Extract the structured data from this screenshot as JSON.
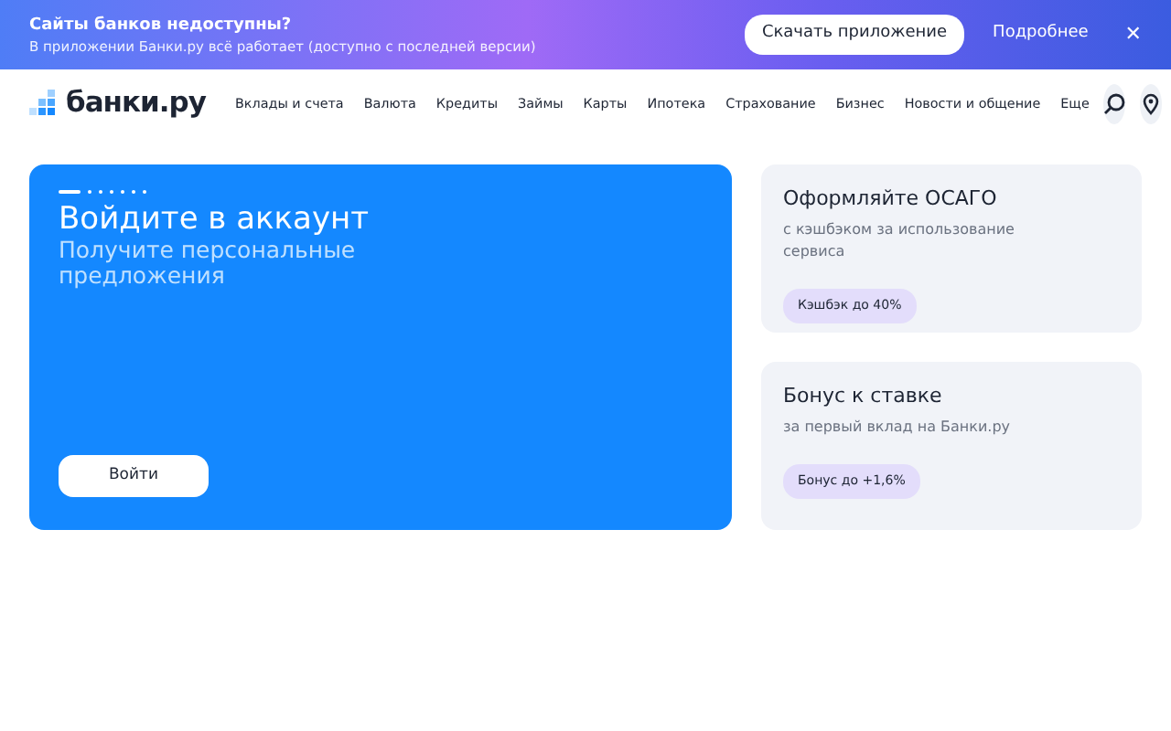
{
  "banner": {
    "title": "Сайты банков недоступны?",
    "text": "В приложении Банки.ру всё работает (доступно с последней версии)",
    "download_button": "Скачать приложение",
    "more_link": "Подробнее",
    "close": "✕"
  },
  "header": {
    "logo": "банки.ру",
    "nav": [
      "Вклады и счета",
      "Валюта",
      "Кредиты",
      "Займы",
      "Карты",
      "Ипотека",
      "Страхование",
      "Бизнес",
      "Новости и общение",
      "Еще"
    ]
  },
  "hero": {
    "slides": [
      {
        "selected": true
      },
      {
        "selected": false
      },
      {
        "selected": false
      },
      {
        "selected": false
      },
      {
        "selected": false
      },
      {
        "selected": false
      },
      {
        "selected": false
      }
    ],
    "title": "Войдите в аккаунт",
    "subtitle": "Получите персональные предложения",
    "button": "Войти"
  },
  "promos": [
    {
      "title": "Оформляйте ОСАГО",
      "text": "с кэшбэком за использование сервиса",
      "badge": "Кэшбэк до 40%"
    },
    {
      "title": "Бонус к ставке",
      "text": "за первый вклад на Банки.ру",
      "badge": "Бонус до +1,6%"
    }
  ]
}
